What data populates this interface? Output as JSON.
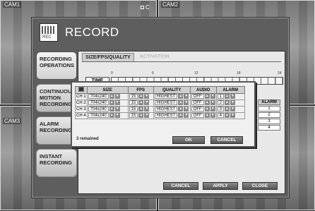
{
  "cameras": {
    "cam1": "CAM1",
    "cam2": "CAM2",
    "cam3": "CAM3"
  },
  "rec_indicator": "C",
  "dialog": {
    "title": "RECORD",
    "icon_text": "REC"
  },
  "sidebar": {
    "items": [
      {
        "label": "RECORDING OPERATIONS"
      },
      {
        "label": "CONTINUOUS/ MOTION RECORDING"
      },
      {
        "label": "ALARM RECORDING"
      },
      {
        "label": "INSTANT RECORDING"
      }
    ]
  },
  "tabs": [
    {
      "label": "SIZE/FPS/QUALITY"
    },
    {
      "label": "ACTIVATION"
    }
  ],
  "timeline": {
    "label": "TIME",
    "ticks": [
      "0",
      "6",
      "12",
      "18",
      "24"
    ]
  },
  "alarm_column": {
    "header": "ALARM",
    "values": [
      "1",
      "2",
      "3",
      "4"
    ]
  },
  "settings_table": {
    "headers": [
      "",
      "SIZE",
      "FPS",
      "QUALITY",
      "AUDIO",
      "ALARM"
    ],
    "rows": [
      {
        "ch": "CH 1",
        "size": "704x240",
        "fps": "15",
        "quality": "HIGHEST",
        "audio": "OFF",
        "alarm": "1"
      },
      {
        "ch": "CH 2",
        "size": "704x240",
        "fps": "15",
        "quality": "HIGHEST",
        "audio": "OFF",
        "alarm": "2"
      },
      {
        "ch": "CH 3",
        "size": "704x240",
        "fps": "15",
        "quality": "HIGHEST",
        "audio": "OFF",
        "alarm": "3"
      },
      {
        "ch": "CH 4",
        "size": "704x240",
        "fps": "15",
        "quality": "HIGHEST",
        "audio": "OFF",
        "alarm": "4"
      }
    ]
  },
  "popup": {
    "remained": "3 remained",
    "ok": "OK",
    "cancel": "CANCEL"
  },
  "footer": {
    "cancel": "CANCEL",
    "apply": "APPLY",
    "close": "CLOSE"
  }
}
